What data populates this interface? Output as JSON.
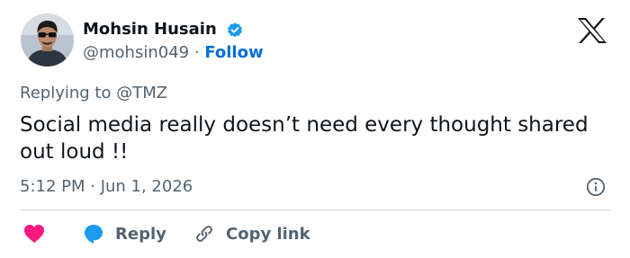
{
  "author": {
    "name": "Mohsin Husain",
    "handle": "@mohsin049",
    "separator": "·",
    "follow_label": "Follow"
  },
  "reply_context": "Replying to @TMZ",
  "tweet": {
    "text": "Social media really doesn’t need every thought shared out loud !!",
    "timestamp": "5:12 PM · Jun 1, 2026"
  },
  "actions": {
    "reply_label": "Reply",
    "copy_link_label": "Copy link"
  },
  "icons": {
    "verified": "verified-badge-icon",
    "x_logo": "x-logo-icon",
    "info": "info-icon",
    "like": "heart-icon",
    "reply": "speech-bubble-icon",
    "copy_link": "link-icon"
  },
  "colors": {
    "verified_badge": "#1d9bf0",
    "follow_link": "#006fd6",
    "like_heart": "#f91880",
    "reply_bubble": "#1d9bf0",
    "secondary_text": "#536471",
    "primary_text": "#0f1419"
  }
}
